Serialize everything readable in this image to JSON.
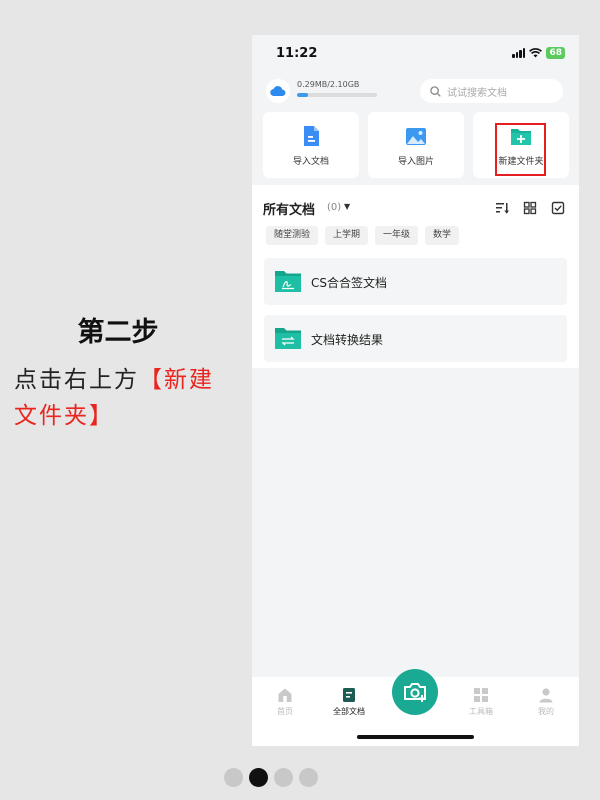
{
  "tutorial": {
    "step_title": "第二步",
    "instruction_plain": "点击右上方",
    "instruction_highlight": "【新建文件夹】"
  },
  "status_bar": {
    "time": "11:22",
    "battery": "68"
  },
  "storage": {
    "text": "0.29MB/2.10GB",
    "used_fraction": 0.14
  },
  "search": {
    "placeholder": "试试搜索文档"
  },
  "actions": [
    {
      "label": "导入文档",
      "icon": "import-doc-icon"
    },
    {
      "label": "导入图片",
      "icon": "import-image-icon"
    },
    {
      "label": "新建文件夹",
      "icon": "new-folder-icon"
    }
  ],
  "docs": {
    "title": "所有文档",
    "count": "(0)",
    "tags": [
      "随堂测验",
      "上学期",
      "一年级",
      "数学"
    ],
    "folders": [
      {
        "name": "CS合合签文档",
        "icon": "signature-folder-icon"
      },
      {
        "name": "文档转换结果",
        "icon": "convert-folder-icon"
      }
    ]
  },
  "tab_bar": {
    "items": [
      {
        "label": "首页",
        "icon": "home-icon"
      },
      {
        "label": "全部文档",
        "icon": "document-icon",
        "active": true
      },
      {
        "label": "",
        "icon": "camera-icon"
      },
      {
        "label": "工具箱",
        "icon": "grid-icon"
      },
      {
        "label": "我的",
        "icon": "user-icon"
      }
    ]
  },
  "colors": {
    "accent": "#1aaa94",
    "highlight_red": "#e8251f",
    "folder_teal": "#19b39b",
    "blue": "#3b8cf5"
  },
  "pagination": {
    "current": 2,
    "total": 4
  }
}
